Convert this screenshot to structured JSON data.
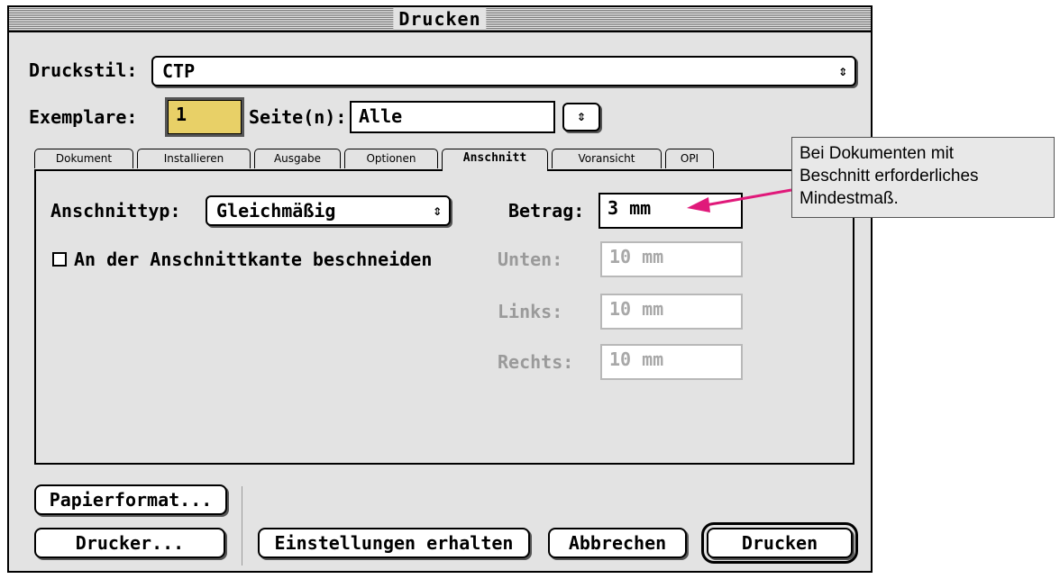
{
  "window": {
    "title": "Drucken"
  },
  "top": {
    "druckstil_label": "Druckstil:",
    "druckstil_value": "CTP",
    "exemplare_label": "Exemplare:",
    "exemplare_value": "1",
    "seiten_label": "Seite(n):",
    "seiten_value": "Alle"
  },
  "tabs": [
    {
      "label": "Dokument"
    },
    {
      "label": "Installieren"
    },
    {
      "label": "Ausgabe"
    },
    {
      "label": "Optionen"
    },
    {
      "label": "Anschnitt",
      "active": true
    },
    {
      "label": "Voransicht"
    },
    {
      "label": "OPI"
    }
  ],
  "panel": {
    "anschnitttyp_label": "Anschnittyp:",
    "anschnitttyp_value": "Gleichmäßig",
    "checkbox_label": "An der Anschnittkante beschneiden",
    "checkbox_checked": false,
    "betrag_label": "Betrag:",
    "betrag_value": "3 mm",
    "unten_label": "Unten:",
    "unten_value": "10 mm",
    "links_label": "Links:",
    "links_value": "10 mm",
    "rechts_label": "Rechts:",
    "rechts_value": "10 mm"
  },
  "buttons": {
    "papierformat": "Papierformat...",
    "drucker": "Drucker...",
    "einstellungen": "Einstellungen erhalten",
    "abbrechen": "Abbrechen",
    "drucken": "Drucken"
  },
  "callout": {
    "line1": "Bei Dokumenten mit",
    "line2": "Beschnitt erforderliches",
    "line3": "Mindestmaß."
  },
  "icons": {
    "popup_arrows": "updown-arrows-icon"
  },
  "colors": {
    "highlight": "#e8d067",
    "callout_arrow": "#e0197a"
  }
}
